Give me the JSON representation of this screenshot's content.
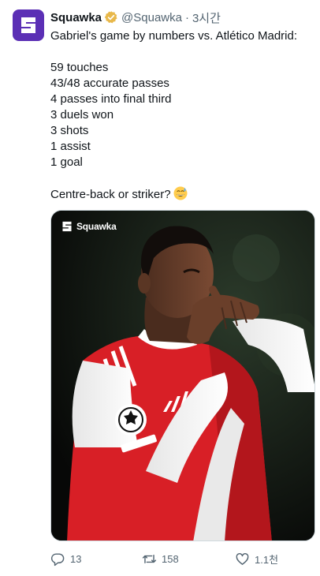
{
  "author": {
    "display_name": "Squawka",
    "handle": "@Squawka",
    "separator": "·",
    "timestamp": "3시간",
    "verified_icon": "verified-badge-icon",
    "avatar_icon": "squawka-logo-icon"
  },
  "tweet": {
    "lines": [
      "Gabriel's game by numbers vs. Atlético Madrid:",
      "",
      "59 touches",
      "43/48 accurate passes",
      "4 passes into final third",
      "3 duels won",
      "3 shots",
      "1 assist",
      "1 goal",
      "",
      "Centre-back or striker?"
    ],
    "emoji": "sweat-smile-emoji"
  },
  "media": {
    "watermark": "Squawka",
    "description_icon": "player-photo"
  },
  "actions": {
    "replies": "13",
    "retweets": "158",
    "likes": "1.1천"
  },
  "colors": {
    "avatar_bg": "#5b2fb5",
    "verified": "#e8b84a",
    "secondary_text": "#536471",
    "kit_red": "#d81f26"
  }
}
